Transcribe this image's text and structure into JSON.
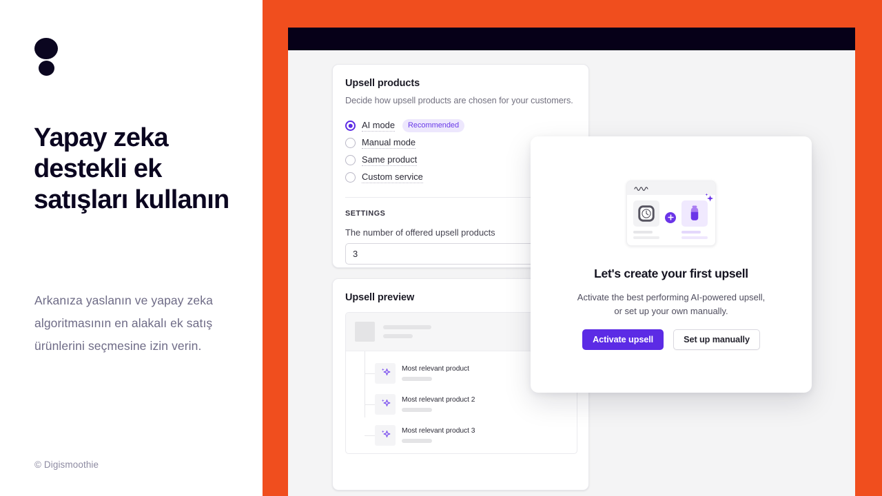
{
  "brand": {
    "logo_icon": "two-dots-logo",
    "accent_orange": "#f04e1e",
    "accent_purple": "#5c2be5",
    "dark": "#0b0620"
  },
  "left": {
    "headline": "Yapay zeka destekli ek satışları kullanın",
    "subcopy": "Arkanıza yaslanın ve yapay zeka algoritmasının en alakalı ek satış ürünlerini seçmesine izin verin.",
    "copyright": "© Digismoothie"
  },
  "app": {
    "topbar": ""
  },
  "upsell_card": {
    "title": "Upsell products",
    "subtitle": "Decide how upsell products are chosen for your customers.",
    "options": [
      {
        "label": "AI mode",
        "selected": true,
        "badge": "Recommended"
      },
      {
        "label": "Manual mode",
        "selected": false,
        "badge": ""
      },
      {
        "label": "Same product",
        "selected": false,
        "badge": ""
      },
      {
        "label": "Custom service",
        "selected": false,
        "badge": ""
      }
    ],
    "settings_label": "SETTINGS",
    "field_label": "The number of offered upsell products",
    "field_value": "3"
  },
  "preview_card": {
    "title": "Upsell preview",
    "items": [
      {
        "name": "Most relevant product",
        "icon": "sparkle-icon"
      },
      {
        "name": "Most relevant product 2",
        "icon": "sparkle-icon"
      },
      {
        "name": "Most relevant product 3",
        "icon": "sparkle-icon"
      }
    ]
  },
  "modal": {
    "illustration": {
      "left_product_icon": "clock-watch-icon",
      "plus_icon": "plus-icon",
      "right_product_icon": "bottle-icon",
      "sparkle_icon": "sparkle-icon"
    },
    "title": "Let's create your first upsell",
    "description_line1": "Activate the best performing AI-powered upsell,",
    "description_line2": "or set up your own manually.",
    "primary_button": "Activate upsell",
    "secondary_button": "Set up manually"
  }
}
